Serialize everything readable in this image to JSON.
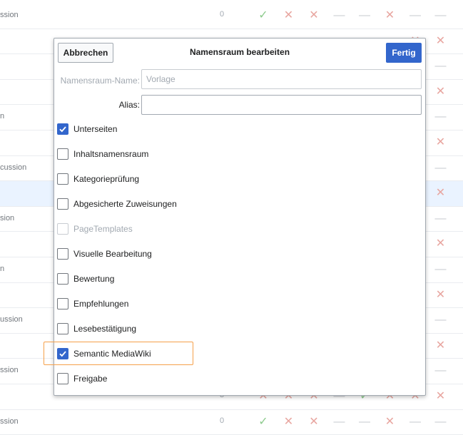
{
  "background": {
    "rows": [
      {
        "label": "ssion",
        "count": "0",
        "cells": [
          "c",
          "x",
          "x",
          "d",
          "d",
          "x",
          "d",
          "d"
        ],
        "hl": false
      },
      {
        "label": "",
        "count": "",
        "cells": [
          "",
          "",
          "",
          "",
          "",
          "",
          "x",
          "x"
        ],
        "hl": false
      },
      {
        "label": "",
        "count": "",
        "cells": [
          "",
          "",
          "",
          "",
          "",
          "",
          "d",
          "d"
        ],
        "hl": false
      },
      {
        "label": "",
        "count": "",
        "cells": [
          "",
          "",
          "",
          "",
          "",
          "",
          "x",
          "x"
        ],
        "hl": false
      },
      {
        "label": "n",
        "count": "",
        "cells": [
          "",
          "",
          "",
          "",
          "",
          "",
          "d",
          "d"
        ],
        "hl": false
      },
      {
        "label": "",
        "count": "",
        "cells": [
          "",
          "",
          "",
          "",
          "",
          "",
          "x",
          "x"
        ],
        "hl": false
      },
      {
        "label": "cussion",
        "count": "",
        "cells": [
          "",
          "",
          "",
          "",
          "",
          "",
          "d",
          "d"
        ],
        "hl": false
      },
      {
        "label": "",
        "count": "",
        "cells": [
          "",
          "",
          "",
          "",
          "",
          "",
          "x",
          "x"
        ],
        "hl": true
      },
      {
        "label": "sion",
        "count": "",
        "cells": [
          "",
          "",
          "",
          "",
          "",
          "",
          "d",
          "d"
        ],
        "hl": false
      },
      {
        "label": "",
        "count": "",
        "cells": [
          "",
          "",
          "",
          "",
          "",
          "",
          "x",
          "x"
        ],
        "hl": false
      },
      {
        "label": "n",
        "count": "",
        "cells": [
          "",
          "",
          "",
          "",
          "",
          "",
          "d",
          "d"
        ],
        "hl": false
      },
      {
        "label": "",
        "count": "",
        "cells": [
          "",
          "",
          "",
          "",
          "",
          "",
          "x",
          "x"
        ],
        "hl": false
      },
      {
        "label": "ussion",
        "count": "",
        "cells": [
          "",
          "",
          "",
          "",
          "",
          "",
          "d",
          "d"
        ],
        "hl": false
      },
      {
        "label": "",
        "count": "",
        "cells": [
          "",
          "",
          "",
          "",
          "",
          "",
          "x",
          "x"
        ],
        "hl": false
      },
      {
        "label": "ssion",
        "count": "",
        "cells": [
          "",
          "",
          "",
          "",
          "",
          "",
          "d",
          "d"
        ],
        "hl": false
      },
      {
        "label": "",
        "count": "3",
        "cells": [
          "x",
          "x",
          "x",
          "d",
          "c",
          "x",
          "x",
          "x"
        ],
        "hl": false
      },
      {
        "label": "ssion",
        "count": "0",
        "cells": [
          "c",
          "x",
          "x",
          "d",
          "d",
          "x",
          "d",
          "d"
        ],
        "hl": false
      }
    ]
  },
  "dialog": {
    "title": "Namensraum bearbeiten",
    "cancel_label": "Abbrechen",
    "done_label": "Fertig",
    "namespace_name_label": "Namensraum-Name:",
    "namespace_name_value": "Vorlage",
    "alias_label": "Alias:",
    "alias_value": "",
    "options": [
      {
        "label": "Unterseiten",
        "checked": true,
        "disabled": false
      },
      {
        "label": "Inhaltsnamensraum",
        "checked": false,
        "disabled": false
      },
      {
        "label": "Kategorieprüfung",
        "checked": false,
        "disabled": false
      },
      {
        "label": "Abgesicherte Zuweisungen",
        "checked": false,
        "disabled": false
      },
      {
        "label": "PageTemplates",
        "checked": false,
        "disabled": true
      },
      {
        "label": "Visuelle Bearbeitung",
        "checked": false,
        "disabled": false
      },
      {
        "label": "Bewertung",
        "checked": false,
        "disabled": false
      },
      {
        "label": "Empfehlungen",
        "checked": false,
        "disabled": false
      },
      {
        "label": "Lesebestätigung",
        "checked": false,
        "disabled": false
      },
      {
        "label": "Semantic MediaWiki",
        "checked": true,
        "disabled": false
      },
      {
        "label": "Freigabe",
        "checked": false,
        "disabled": false
      }
    ]
  },
  "colors": {
    "accent": "#3366cc",
    "highlight": "#f5a04a",
    "cross": "#e8a6a0",
    "check": "#8ecb8e"
  }
}
